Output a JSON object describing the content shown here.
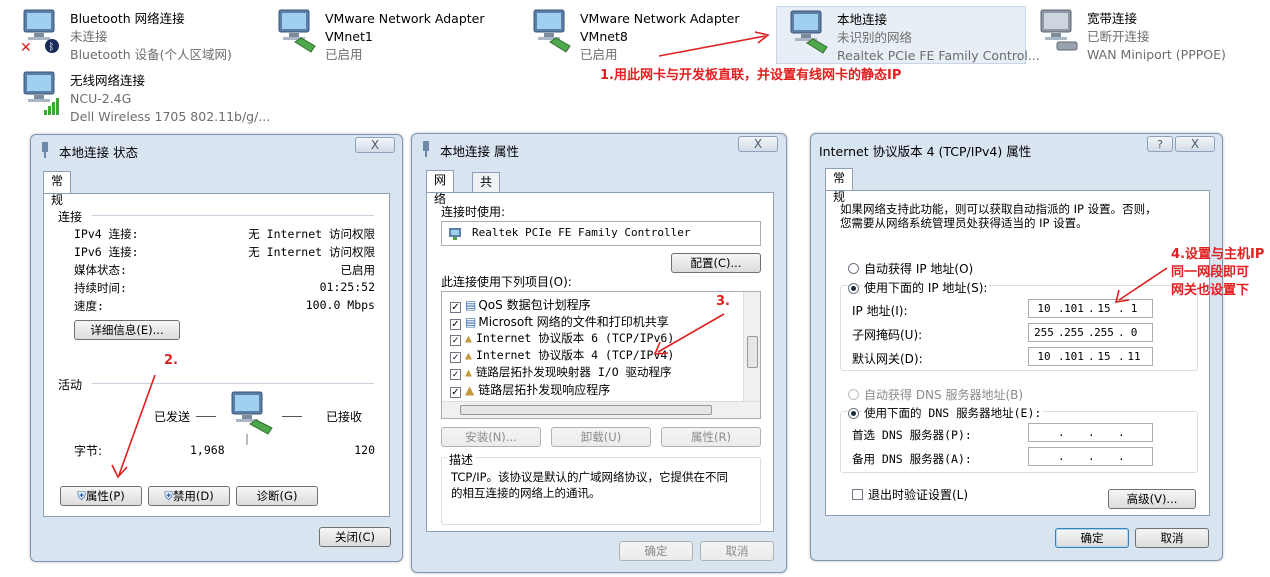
{
  "adapters": [
    {
      "name": "Bluetooth 网络连接",
      "status": "未连接",
      "device": "Bluetooth 设备(个人区域网)",
      "icon": "bluetooth-adapter-icon"
    },
    {
      "name": "VMware Network Adapter VMnet1",
      "status": "已启用",
      "device": "",
      "icon": "network-adapter-icon"
    },
    {
      "name": "VMware Network Adapter VMnet8",
      "status": "已启用",
      "device": "",
      "icon": "network-adapter-icon"
    },
    {
      "name": "本地连接",
      "status": "未识别的网络",
      "device": "Realtek PCIe FE Family Control...",
      "icon": "network-adapter-icon",
      "selected": true
    },
    {
      "name": "宽带连接",
      "status": "已断开连接",
      "device": "WAN Miniport (PPPOE)",
      "icon": "broadband-adapter-icon"
    },
    {
      "name": "无线网络连接",
      "status": "NCU-2.4G",
      "device": "Dell Wireless 1705 802.11b/g/...",
      "icon": "wireless-adapter-icon"
    }
  ],
  "annotations": {
    "a1": "1.用此网卡与开发板直联，并设置有线网卡的静态IP",
    "a2": "2.",
    "a3": "3.",
    "a4_l1": "4.设置与主机IP",
    "a4_l2": "同一网段即可",
    "a4_l3": "网关也设置下",
    "color": "#e02020"
  },
  "status_dialog": {
    "title": "本地连接 状态",
    "close_x": "X",
    "tab": "常规",
    "connection_header": "连接",
    "rows": [
      {
        "label": "IPv4 连接:",
        "value": "无 Internet 访问权限"
      },
      {
        "label": "IPv6 连接:",
        "value": "无 Internet 访问权限"
      },
      {
        "label": "媒体状态:",
        "value": "已启用"
      },
      {
        "label": "持续时间:",
        "value": "01:25:52"
      },
      {
        "label": "速度:",
        "value": "100.0 Mbps"
      }
    ],
    "details_button": "详细信息(E)...",
    "activity_header": "活动",
    "sent_label": "已发送",
    "received_label": "已接收",
    "bytes_label": "字节:",
    "bytes_sent": "1,968",
    "bytes_received": "120",
    "properties_button": "属性(P)",
    "disable_button": "禁用(D)",
    "diagnose_button": "诊断(G)",
    "close_button": "关闭(C)"
  },
  "properties_dialog": {
    "title": "本地连接 属性",
    "close_x": "X",
    "tab_network": "网络",
    "tab_sharing": "共享",
    "connect_using_label": "连接时使用:",
    "adapter_name": "Realtek PCIe FE Family Controller",
    "configure_button": "配置(C)...",
    "items_label": "此连接使用下列项目(O):",
    "items": [
      {
        "label": "QoS 数据包计划程序",
        "checked": true,
        "icon": "qos-icon"
      },
      {
        "label": "Microsoft 网络的文件和打印机共享",
        "checked": true,
        "icon": "file-share-icon"
      },
      {
        "label": "Internet 协议版本 6 (TCP/IPv6)",
        "checked": true,
        "icon": "protocol-icon"
      },
      {
        "label": "Internet 协议版本 4 (TCP/IPv4)",
        "checked": true,
        "icon": "protocol-icon"
      },
      {
        "label": "链路层拓扑发现映射器 I/O 驱动程序",
        "checked": true,
        "icon": "protocol-icon"
      },
      {
        "label": "链路层拓扑发现响应程序",
        "checked": true,
        "icon": "protocol-icon"
      }
    ],
    "install_button": "安装(N)...",
    "uninstall_button": "卸载(U)",
    "properties_button": "属性(R)",
    "description_header": "描述",
    "description_text_1": "TCP/IP。该协议是默认的广域网络协议，它提供在不同",
    "description_text_2": "的相互连接的网络上的通讯。",
    "ok_button": "确定",
    "cancel_button": "取消"
  },
  "ipv4_dialog": {
    "title": "Internet 协议版本 4 (TCP/IPv4) 属性",
    "help": "?",
    "close_x": "X",
    "tab": "常规",
    "intro_1": "如果网络支持此功能，则可以获取自动指派的 IP 设置。否则，",
    "intro_2": "您需要从网络系统管理员处获得适当的 IP 设置。",
    "auto_ip": "自动获得 IP 地址(O)",
    "use_ip": "使用下面的 IP 地址(S):",
    "ip_label": "IP 地址(I):",
    "ip_value": [
      "10",
      "101",
      "15",
      "1"
    ],
    "mask_label": "子网掩码(U):",
    "mask_value": [
      "255",
      "255",
      "255",
      "0"
    ],
    "gateway_label": "默认网关(D):",
    "gateway_value": [
      "10",
      "101",
      "15",
      "11"
    ],
    "auto_dns": "自动获得 DNS 服务器地址(B)",
    "use_dns": "使用下面的 DNS 服务器地址(E):",
    "preferred_dns": "首选 DNS 服务器(P):",
    "alternate_dns": "备用 DNS 服务器(A):",
    "validate": "退出时验证设置(L)",
    "advanced_button": "高级(V)...",
    "ok_button": "确定",
    "cancel_button": "取消"
  }
}
